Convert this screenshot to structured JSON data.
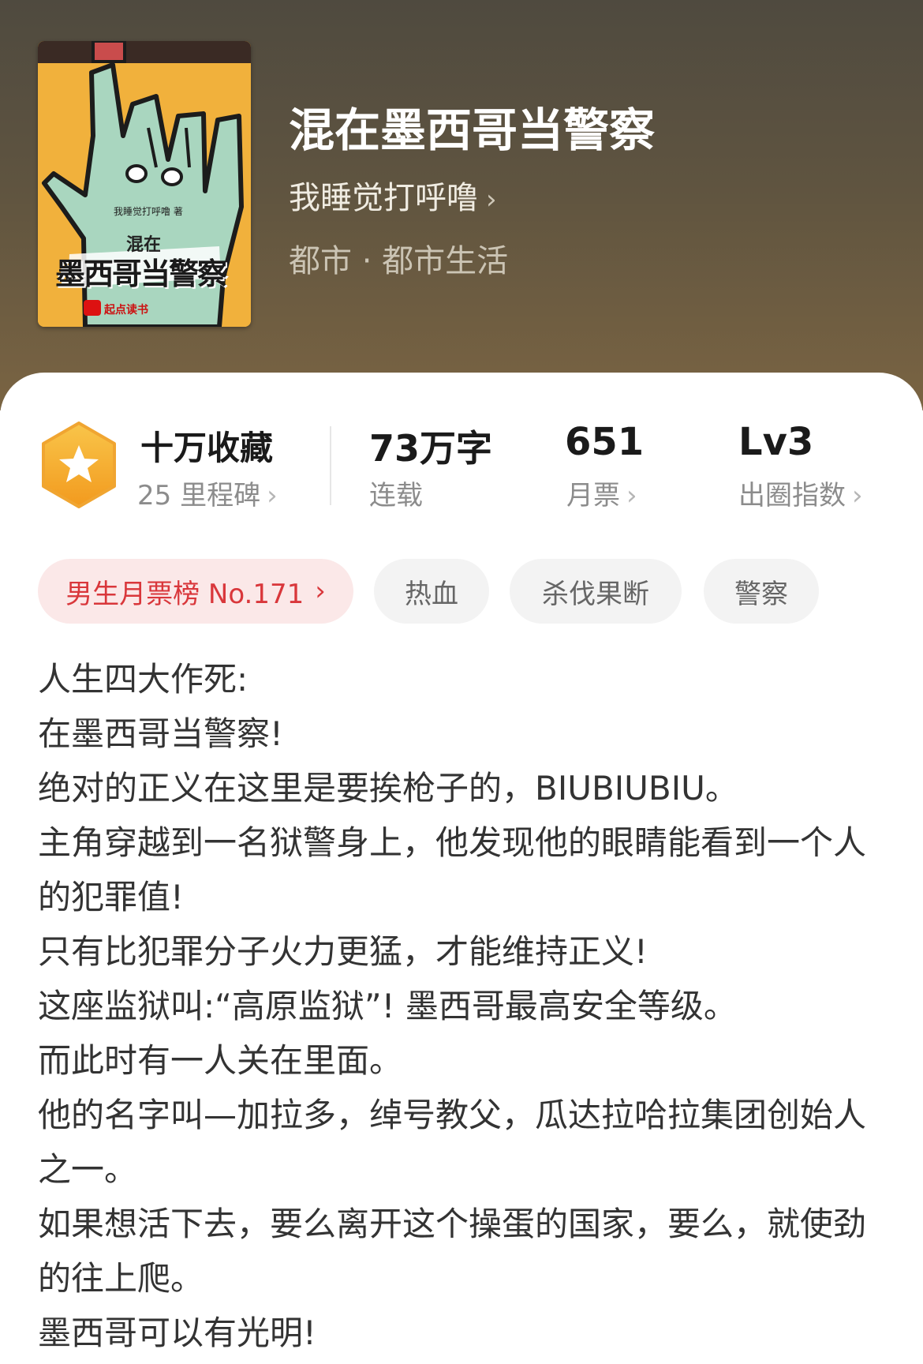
{
  "book": {
    "title": "混在墨西哥当警察",
    "author": "我睡觉打呼噜",
    "genre": "都市 · 都市生活",
    "cover": {
      "author_small": "我睡觉打呼噜 著",
      "title_top": "混在",
      "title_main": "墨西哥当警察",
      "brand": "起点读书"
    }
  },
  "stats": {
    "collections": {
      "value": "十万收藏",
      "sub": "25 里程碑"
    },
    "words": {
      "value": "73万字",
      "sub": "连载"
    },
    "tickets": {
      "value": "651",
      "sub": "月票"
    },
    "influence": {
      "value": "Lv3",
      "sub": "出圈指数"
    }
  },
  "tags": [
    {
      "label": "男生月票榜 No.171"
    },
    {
      "label": "热血"
    },
    {
      "label": "杀伐果断"
    },
    {
      "label": "警察"
    }
  ],
  "description": [
    "人生四大作死:",
    "在墨西哥当警察!",
    "绝对的正义在这里是要挨枪子的，BIUBIUBIU。",
    "主角穿越到一名狱警身上，他发现他的眼睛能看到一个人的犯罪值!",
    "只有比犯罪分子火力更猛，才能维持正义!",
    "这座监狱叫:“高原监狱”! 墨西哥最高安全等级。",
    "而此时有一人关在里面。",
    "他的名字叫—加拉多，绰号教父，瓜达拉哈拉集团创始人之一。",
    "如果想活下去，要么离开这个操蛋的国家，要么，就使劲的往上爬。",
    "墨西哥可以有光明!"
  ],
  "icons": {
    "chevron": "chevron-right-icon",
    "badge": "star-hexagon-icon"
  },
  "colors": {
    "accent_red": "#d9373b",
    "badge_orange": "#f5a623"
  }
}
